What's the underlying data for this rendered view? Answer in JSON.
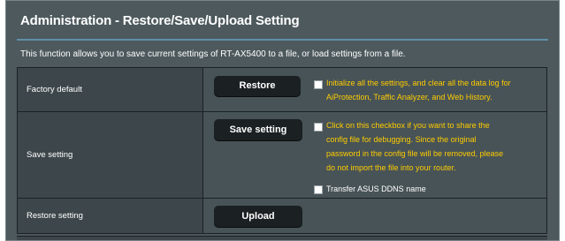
{
  "header": {
    "title": "Administration - Restore/Save/Upload Setting",
    "description": "This function allows you to save current settings of RT-AX5400 to a file, or load settings from a file."
  },
  "rows": [
    {
      "label": "Factory default",
      "button": "Restore",
      "checkbox_text": "Initialize all the settings, and clear all the data log for\nAiProtection, Traffic Analyzer, and Web History."
    },
    {
      "label": "Save setting",
      "button": "Save setting",
      "checkbox_text": "Click on this checkbox if you want to share the\nconfig file for debugging. Since the original\npassword in the config file will be removed, please\ndo not import the file into your router.",
      "checkbox2_text": "Transfer ASUS DDNS name"
    },
    {
      "label": "Restore setting",
      "button": "Upload"
    }
  ],
  "colors": {
    "panel_bg": "#4d595d",
    "label_bg": "#3d474b",
    "button_bg": "#1b2022",
    "note_yellow": "#ffcc00",
    "separator": "#5f8fa8"
  }
}
